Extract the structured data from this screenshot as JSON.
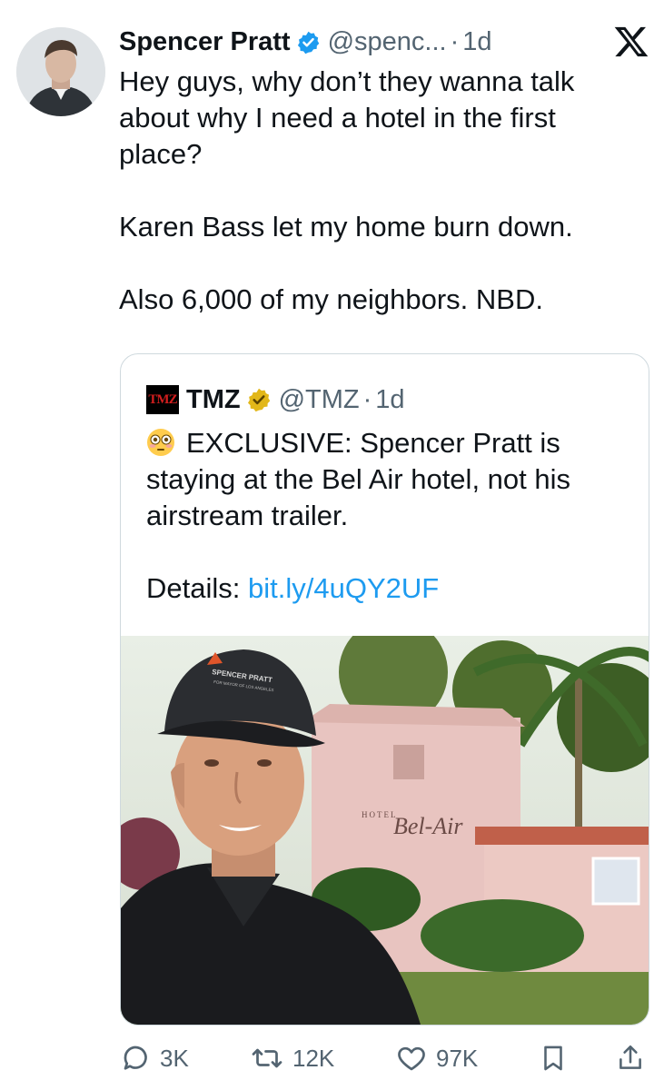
{
  "author": {
    "name": "Spencer Pratt",
    "handle": "@spenc...",
    "separator": "·",
    "time": "1d"
  },
  "tweet_lines_1": "Hey guys, why don’t they wanna talk about why I need a hotel in the first place?",
  "tweet_lines_2": "Karen Bass let my home burn down.",
  "tweet_lines_3": "Also 6,000 of my neighbors. NBD.",
  "quote": {
    "logo_text": "TMZ",
    "name": "TMZ",
    "handle": "@TMZ",
    "separator": "·",
    "time": "1d",
    "text": "EXCLUSIVE: Spencer Pratt is staying at the Bel Air hotel, not his airstream trailer.",
    "details_label": "Details:",
    "link": "bit.ly/4uQY2UF",
    "image": {
      "cap_text_line1": "SPENCER PRATT",
      "cap_text_line2": "FOR MAYOR OF LOS ANGELES",
      "sign_small": "HOTEL",
      "sign_script": "Bel-Air"
    }
  },
  "actions": {
    "replies": "3K",
    "reposts": "12K",
    "likes": "97K"
  },
  "colors": {
    "verified_blue": "#1d9bf0",
    "gold_badge": "#e2b719",
    "link": "#1d9bf0",
    "muted": "#536471"
  }
}
